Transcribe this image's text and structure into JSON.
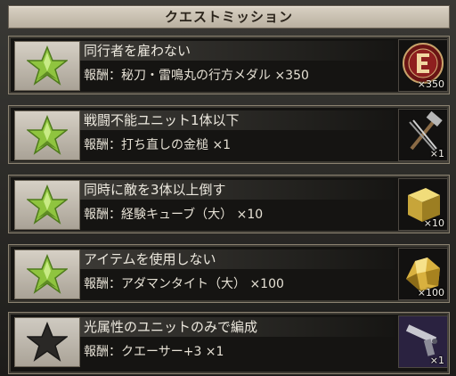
{
  "header": {
    "title": "クエストミッション"
  },
  "missions": [
    {
      "name": "同行者を雇わない",
      "reward": "報酬：秘刀・雷鳴丸の行方メダル ×350",
      "quantity": "×350",
      "completed": true,
      "icon": "medal-icon"
    },
    {
      "name": "戦闘不能ユニット1体以下",
      "reward": "報酬：打ち直しの金槌 ×1",
      "quantity": "×1",
      "completed": true,
      "icon": "hammer-icon"
    },
    {
      "name": "同時に敵を3体以上倒す",
      "reward": "報酬：経験キューブ（大） ×10",
      "quantity": "×10",
      "completed": true,
      "icon": "cube-icon"
    },
    {
      "name": "アイテムを使用しない",
      "reward": "報酬：アダマンタイト（大） ×100",
      "quantity": "×100",
      "completed": true,
      "icon": "ore-icon"
    },
    {
      "name": "光属性のユニットのみで編成",
      "reward": "報酬：クエーサー+3 ×1",
      "quantity": "×1",
      "completed": false,
      "icon": "gun-icon"
    }
  ],
  "colors": {
    "star_on": "#8fc43f",
    "star_off": "#2a2826"
  }
}
